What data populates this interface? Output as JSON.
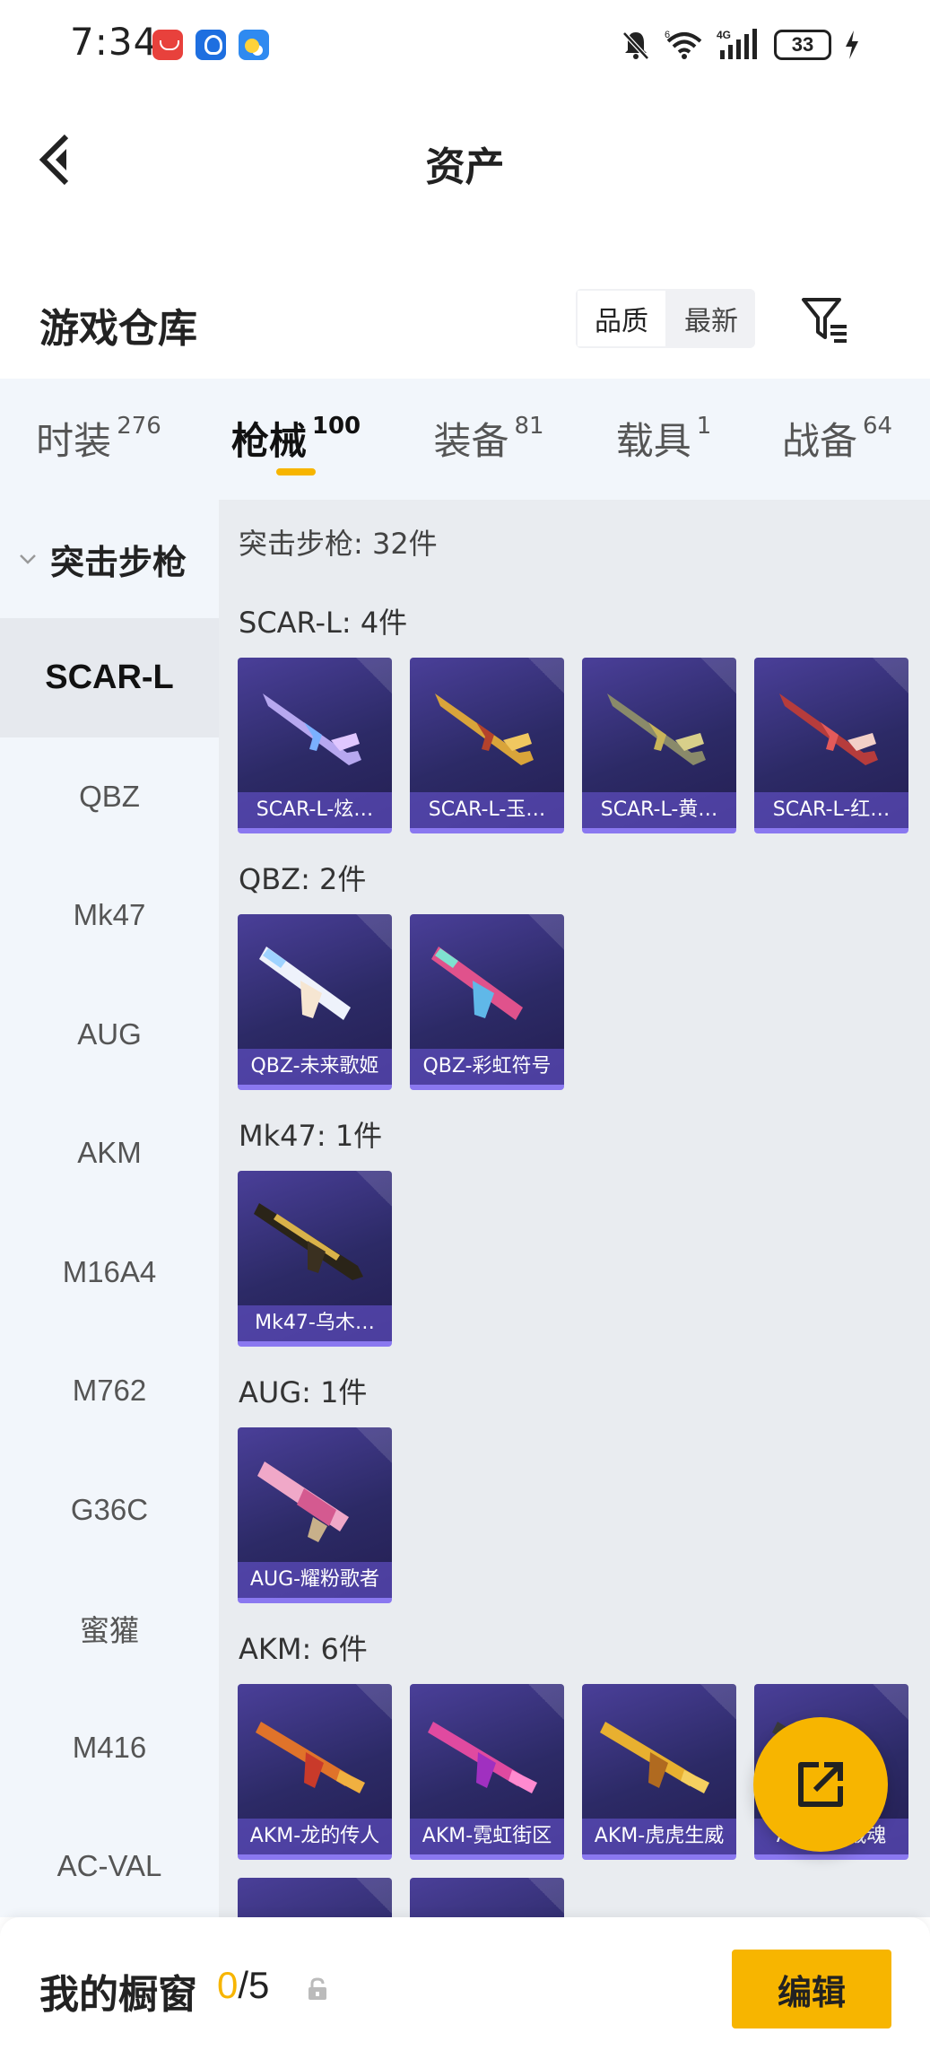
{
  "status_bar": {
    "time": "7:34",
    "network": "4G",
    "wifi_level": "6",
    "battery": "33"
  },
  "header": {
    "title": "资产"
  },
  "section": {
    "title": "游戏仓库",
    "sort_quality": "品质",
    "sort_latest": "最新",
    "active_sort": "品质"
  },
  "tabs": [
    {
      "label": "时装",
      "count": "276"
    },
    {
      "label": "枪械",
      "count": "100"
    },
    {
      "label": "装备",
      "count": "81"
    },
    {
      "label": "载具",
      "count": "1"
    },
    {
      "label": "战备",
      "count": "64"
    }
  ],
  "active_tab": "枪械",
  "side": {
    "group_label": "突击步枪",
    "items": [
      "SCAR-L",
      "QBZ",
      "Mk47",
      "AUG",
      "AKM",
      "M16A4",
      "M762",
      "G36C",
      "蜜獾",
      "M416",
      "AC-VAL"
    ],
    "active_item": "SCAR-L"
  },
  "content": {
    "summary": "突击步枪: 32件",
    "groups": [
      {
        "label": "SCAR-L: 4件",
        "items": [
          "SCAR-L-炫…",
          "SCAR-L-玉…",
          "SCAR-L-黄…",
          "SCAR-L-红…"
        ]
      },
      {
        "label": "QBZ: 2件",
        "items": [
          "QBZ-未来歌姬",
          "QBZ-彩虹符号"
        ]
      },
      {
        "label": "Mk47: 1件",
        "items": [
          "Mk47-乌木…"
        ]
      },
      {
        "label": "AUG: 1件",
        "items": [
          "AUG-耀粉歌者"
        ]
      },
      {
        "label": "AKM: 6件",
        "items": [
          "AKM-龙的传人",
          "AKM-霓虹街区",
          "AKM-虎虎生威",
          "AKM-…战魂"
        ]
      }
    ]
  },
  "bottom": {
    "title": "我的橱窗",
    "current": "0",
    "total": "/5",
    "edit_label": "编辑"
  },
  "colors": {
    "accent": "#f7b500",
    "card_bg": "#2c2a66",
    "tab_bg": "#f2f6fb",
    "content_bg": "#e9ecf0"
  },
  "icons": [
    "back-arrow-icon",
    "filter-icon",
    "share-icon",
    "lock-icon",
    "chevron-down-icon"
  ]
}
